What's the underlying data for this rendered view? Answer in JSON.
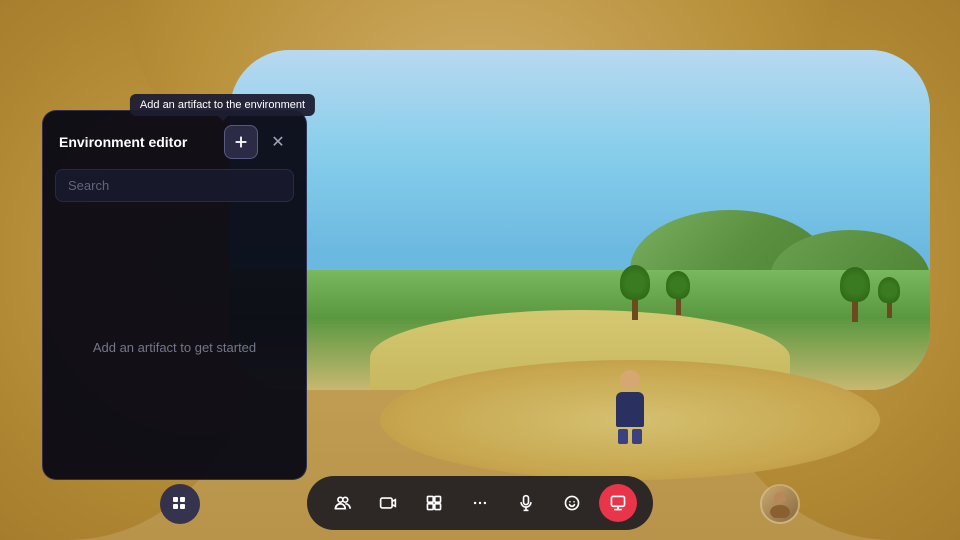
{
  "scene": {
    "bg_color": "#c8a96e"
  },
  "tooltip": {
    "text": "Add an artifact to the environment"
  },
  "panel": {
    "title": "Environment editor",
    "add_button_label": "+",
    "close_button_label": "✕",
    "search_placeholder": "Search",
    "empty_state": "Add an artifact to get started"
  },
  "toolbar": {
    "buttons": [
      {
        "id": "people",
        "icon": "people",
        "label": "People",
        "active": false
      },
      {
        "id": "media",
        "icon": "media",
        "label": "Media",
        "active": false
      },
      {
        "id": "content",
        "icon": "content",
        "label": "Content",
        "active": false
      },
      {
        "id": "more",
        "icon": "more",
        "label": "More",
        "active": false
      },
      {
        "id": "mic",
        "icon": "mic",
        "label": "Microphone",
        "active": false
      },
      {
        "id": "emoji",
        "icon": "emoji",
        "label": "Emoji",
        "active": false
      },
      {
        "id": "share",
        "icon": "share",
        "label": "Share",
        "active": true
      }
    ]
  },
  "left_btn": {
    "label": "Grid"
  },
  "right_btn": {
    "label": "Avatar"
  }
}
